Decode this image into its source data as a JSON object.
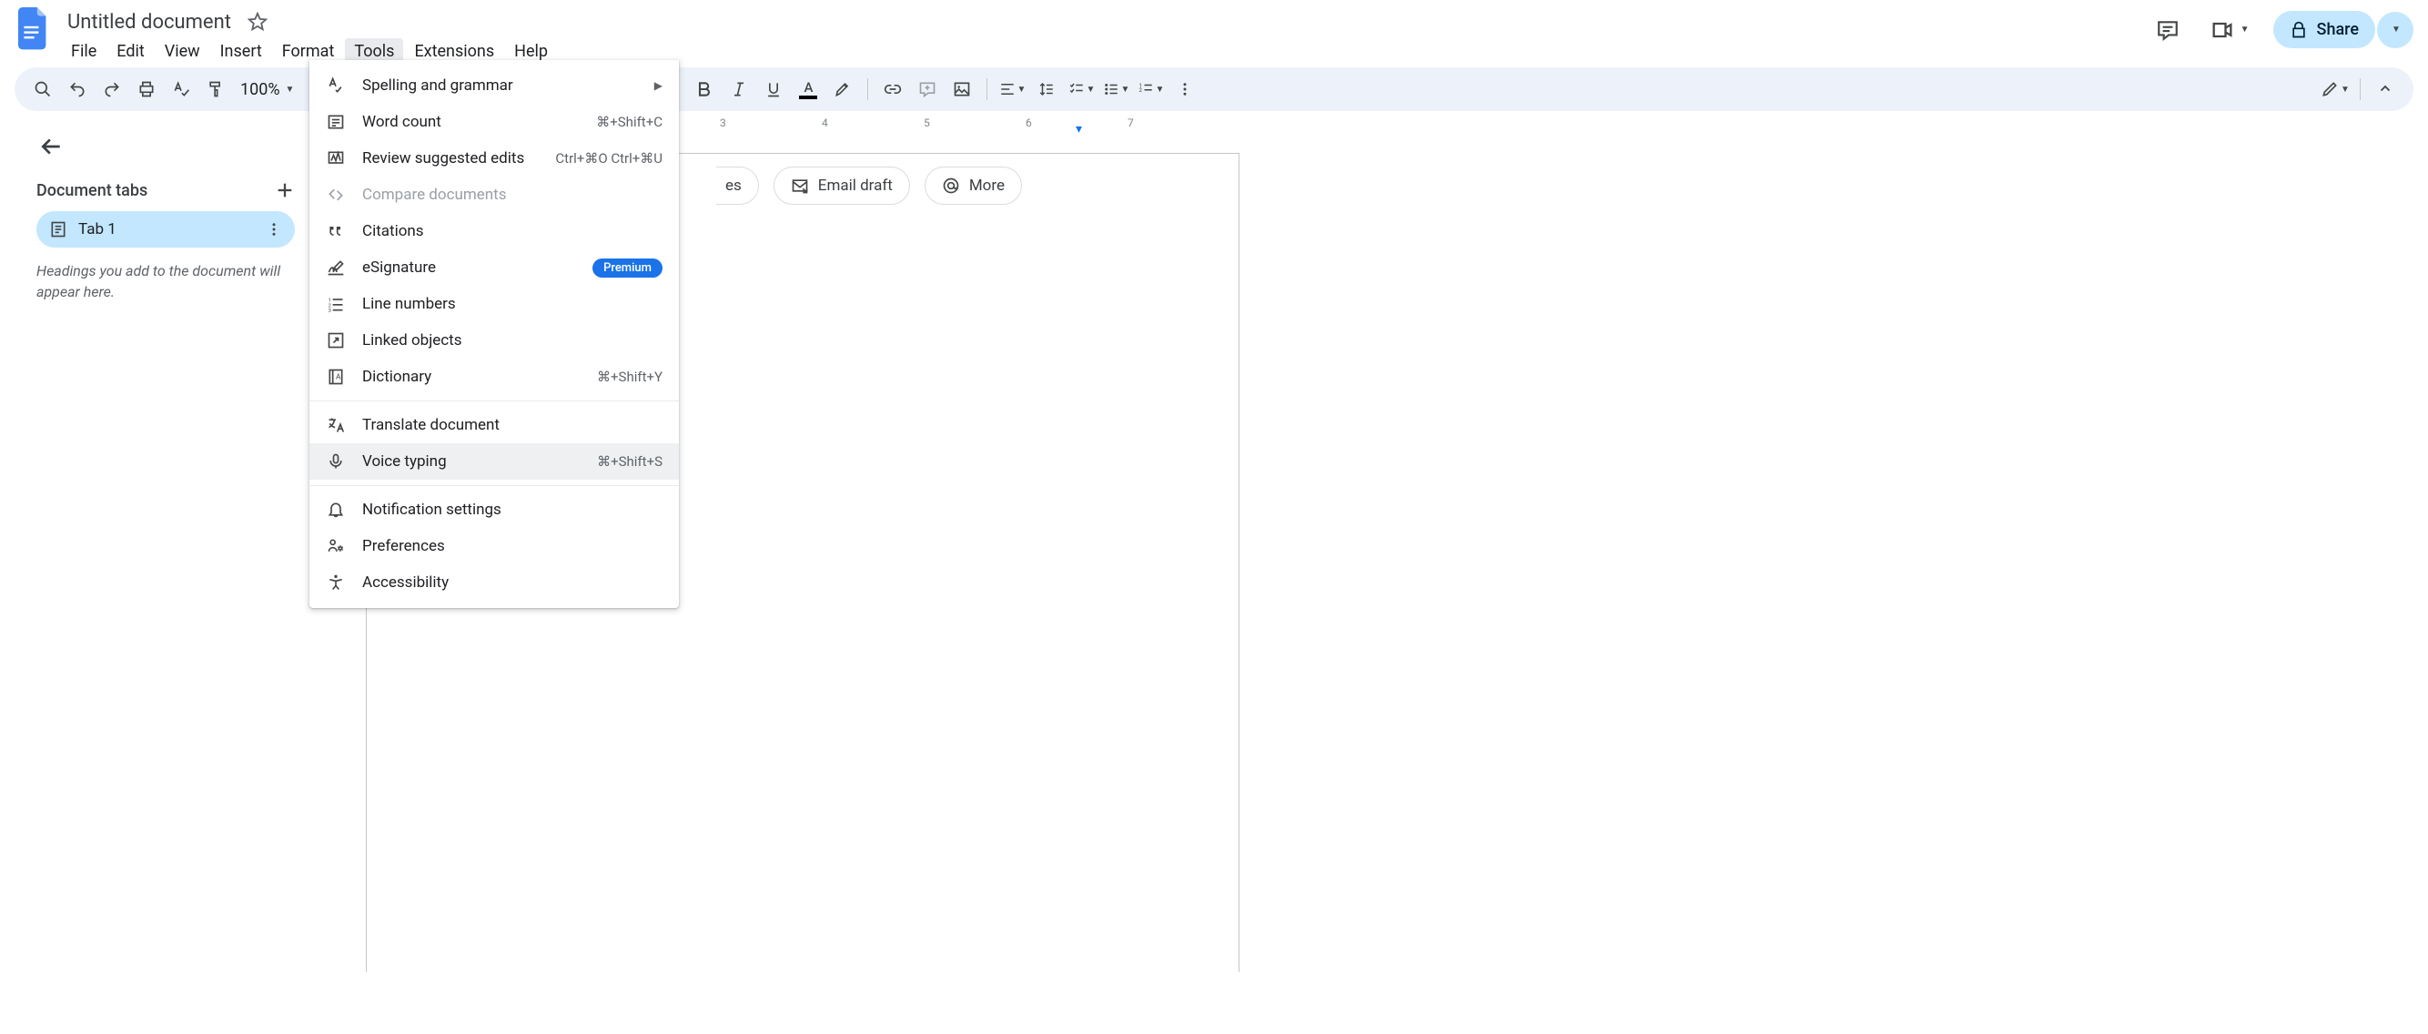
{
  "header": {
    "title": "Untitled document",
    "menus": [
      "File",
      "Edit",
      "View",
      "Insert",
      "Format",
      "Tools",
      "Extensions",
      "Help"
    ],
    "share_label": "Share"
  },
  "toolbar": {
    "zoom": "100%"
  },
  "sidebar": {
    "tabs_title": "Document tabs",
    "tab1_label": "Tab 1",
    "hint": "Headings you add to the document will appear here."
  },
  "chips": {
    "item0_partial": "es",
    "item1": "Email draft",
    "item2": "More"
  },
  "ruler": [
    "3",
    "4",
    "5",
    "6",
    "7"
  ],
  "tools_menu": {
    "spelling": "Spelling and grammar",
    "word_count": "Word count",
    "word_count_sc": "⌘+Shift+C",
    "review": "Review suggested edits",
    "review_sc": "Ctrl+⌘O Ctrl+⌘U",
    "compare": "Compare documents",
    "citations": "Citations",
    "esignature": "eSignature",
    "premium": "Premium",
    "line_numbers": "Line numbers",
    "linked_objects": "Linked objects",
    "dictionary": "Dictionary",
    "dictionary_sc": "⌘+Shift+Y",
    "translate": "Translate document",
    "voice": "Voice typing",
    "voice_sc": "⌘+Shift+S",
    "notification": "Notification settings",
    "preferences": "Preferences",
    "accessibility": "Accessibility"
  }
}
